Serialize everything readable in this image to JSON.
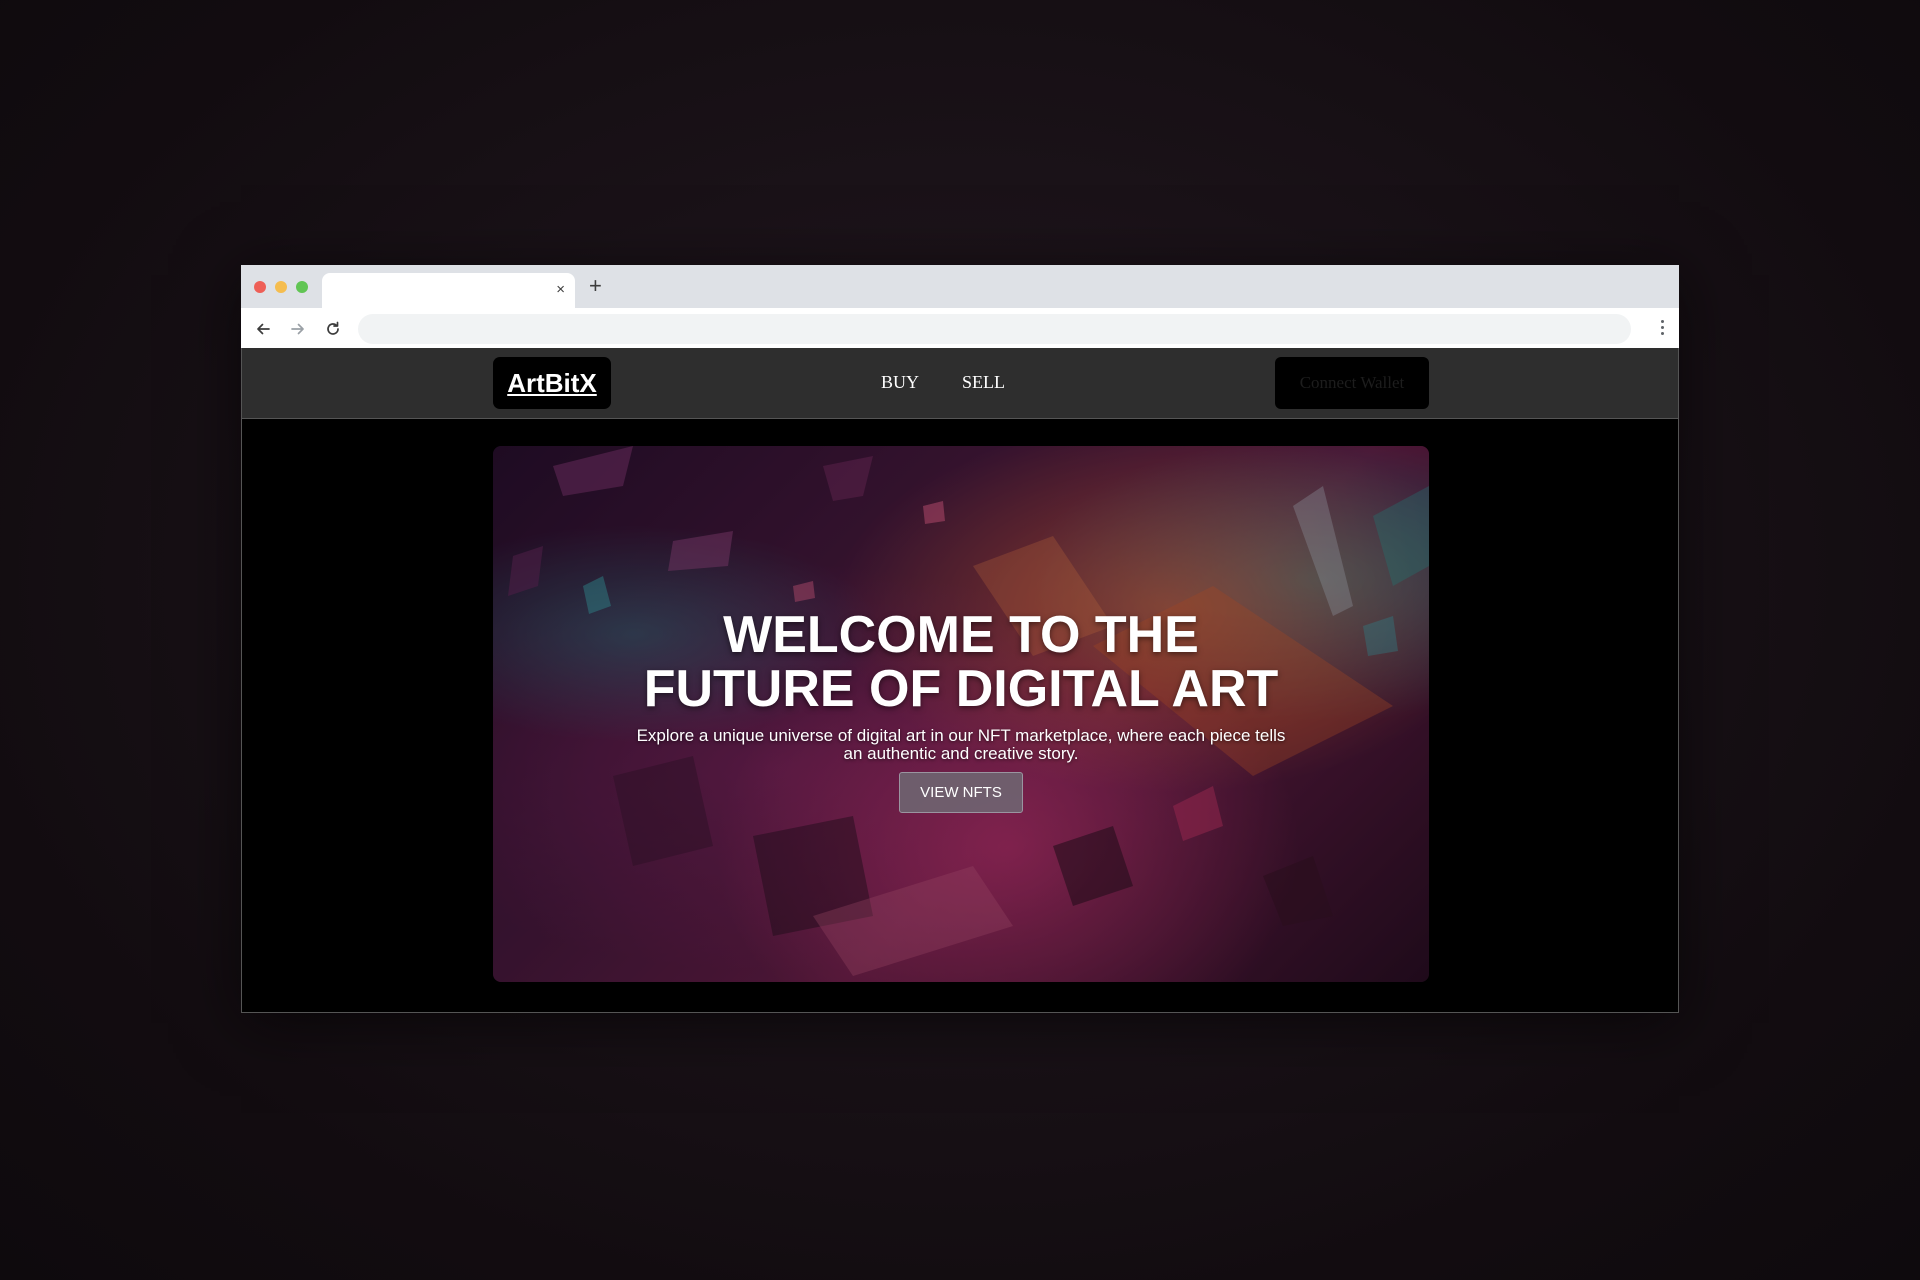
{
  "browser": {
    "tab": {
      "title": "",
      "close_glyph": "×"
    },
    "new_tab_glyph": "+",
    "address_value": ""
  },
  "site": {
    "logo": "ArtBitX",
    "nav": [
      {
        "label": "BUY"
      },
      {
        "label": "SELL"
      }
    ],
    "connect_wallet": "Connect Wallet",
    "hero": {
      "title_line1": "WELCOME TO THE",
      "title_line2": "FUTURE OF DIGITAL ART",
      "subtitle": "Explore a unique universe of digital art in our NFT marketplace, where each piece tells an authentic and creative story.",
      "cta": "VIEW NFTS"
    }
  },
  "icons": {
    "back": "arrow-left-icon",
    "forward": "arrow-right-icon",
    "reload": "reload-icon",
    "menu": "kebab-menu-icon"
  },
  "colors": {
    "nav_bg": "#2e2e2e",
    "page_bg": "#000000",
    "window_dot_red": "#ee5f57",
    "window_dot_yellow": "#f5bd4f",
    "window_dot_green": "#61c554"
  }
}
